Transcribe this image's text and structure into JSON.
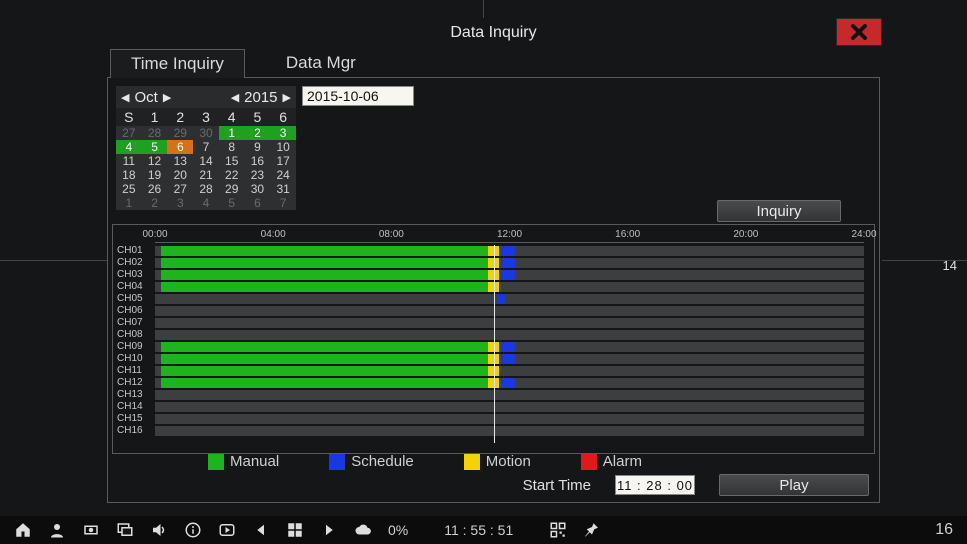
{
  "window": {
    "title": "Data  Inquiry",
    "tabs": [
      {
        "label": "Time  Inquiry",
        "active": true
      },
      {
        "label": "Data  Mgr",
        "active": false
      }
    ]
  },
  "calendar": {
    "month_label": "Oct",
    "year_label": "2015",
    "dow": [
      "S",
      "1",
      "2",
      "3",
      "4",
      "5",
      "6"
    ],
    "cells": [
      {
        "n": "27",
        "cls": "other"
      },
      {
        "n": "28",
        "cls": "other"
      },
      {
        "n": "29",
        "cls": "other"
      },
      {
        "n": "30",
        "cls": "other"
      },
      {
        "n": "1",
        "cls": "rec"
      },
      {
        "n": "2",
        "cls": "rec"
      },
      {
        "n": "3",
        "cls": "rec"
      },
      {
        "n": "4",
        "cls": "rec"
      },
      {
        "n": "5",
        "cls": "rec"
      },
      {
        "n": "6",
        "cls": "sel"
      },
      {
        "n": "7",
        "cls": ""
      },
      {
        "n": "8",
        "cls": ""
      },
      {
        "n": "9",
        "cls": ""
      },
      {
        "n": "10",
        "cls": ""
      },
      {
        "n": "11",
        "cls": ""
      },
      {
        "n": "12",
        "cls": ""
      },
      {
        "n": "13",
        "cls": ""
      },
      {
        "n": "14",
        "cls": ""
      },
      {
        "n": "15",
        "cls": ""
      },
      {
        "n": "16",
        "cls": ""
      },
      {
        "n": "17",
        "cls": ""
      },
      {
        "n": "18",
        "cls": ""
      },
      {
        "n": "19",
        "cls": ""
      },
      {
        "n": "20",
        "cls": ""
      },
      {
        "n": "21",
        "cls": ""
      },
      {
        "n": "22",
        "cls": ""
      },
      {
        "n": "23",
        "cls": ""
      },
      {
        "n": "24",
        "cls": ""
      },
      {
        "n": "25",
        "cls": ""
      },
      {
        "n": "26",
        "cls": ""
      },
      {
        "n": "27",
        "cls": ""
      },
      {
        "n": "28",
        "cls": ""
      },
      {
        "n": "29",
        "cls": ""
      },
      {
        "n": "30",
        "cls": ""
      },
      {
        "n": "31",
        "cls": ""
      },
      {
        "n": "1",
        "cls": "other"
      },
      {
        "n": "2",
        "cls": "other"
      },
      {
        "n": "3",
        "cls": "other"
      },
      {
        "n": "4",
        "cls": "other"
      },
      {
        "n": "5",
        "cls": "other"
      },
      {
        "n": "6",
        "cls": "other"
      },
      {
        "n": "7",
        "cls": "other"
      }
    ]
  },
  "date_field": "2015-10-06",
  "buttons": {
    "inquiry": "Inquiry",
    "play": "Play"
  },
  "timeline": {
    "ticks": [
      "00:00",
      "04:00",
      "08:00",
      "12:00",
      "16:00",
      "20:00",
      "24:00"
    ],
    "playhead_pct": 47.8,
    "channels": [
      {
        "label": "CH01",
        "segs": [
          {
            "t": "manual",
            "s": 0.8,
            "e": 47.0
          },
          {
            "t": "motion",
            "s": 47.0,
            "e": 48.5
          },
          {
            "t": "schedule",
            "s": 49.0,
            "e": 50.8
          }
        ]
      },
      {
        "label": "CH02",
        "segs": [
          {
            "t": "manual",
            "s": 0.8,
            "e": 47.0
          },
          {
            "t": "motion",
            "s": 47.0,
            "e": 48.5
          },
          {
            "t": "schedule",
            "s": 49.0,
            "e": 50.8
          }
        ]
      },
      {
        "label": "CH03",
        "segs": [
          {
            "t": "manual",
            "s": 0.8,
            "e": 47.0
          },
          {
            "t": "motion",
            "s": 47.0,
            "e": 48.5
          },
          {
            "t": "schedule",
            "s": 49.0,
            "e": 50.8
          }
        ]
      },
      {
        "label": "CH04",
        "segs": [
          {
            "t": "manual",
            "s": 0.8,
            "e": 47.0
          },
          {
            "t": "motion",
            "s": 47.0,
            "e": 48.5
          }
        ]
      },
      {
        "label": "CH05",
        "segs": [
          {
            "t": "schedule",
            "s": 48.3,
            "e": 49.3
          }
        ]
      },
      {
        "label": "CH06",
        "segs": []
      },
      {
        "label": "CH07",
        "segs": []
      },
      {
        "label": "CH08",
        "segs": []
      },
      {
        "label": "CH09",
        "segs": [
          {
            "t": "manual",
            "s": 0.8,
            "e": 47.0
          },
          {
            "t": "motion",
            "s": 47.0,
            "e": 48.5
          },
          {
            "t": "schedule",
            "s": 49.0,
            "e": 50.8
          }
        ]
      },
      {
        "label": "CH10",
        "segs": [
          {
            "t": "manual",
            "s": 0.8,
            "e": 47.0
          },
          {
            "t": "motion",
            "s": 47.0,
            "e": 48.5
          },
          {
            "t": "schedule",
            "s": 49.0,
            "e": 50.8
          }
        ]
      },
      {
        "label": "CH11",
        "segs": [
          {
            "t": "manual",
            "s": 0.8,
            "e": 47.0
          },
          {
            "t": "motion",
            "s": 47.0,
            "e": 48.5
          }
        ]
      },
      {
        "label": "CH12",
        "segs": [
          {
            "t": "manual",
            "s": 0.8,
            "e": 47.0
          },
          {
            "t": "motion",
            "s": 47.0,
            "e": 48.5
          },
          {
            "t": "schedule",
            "s": 49.0,
            "e": 50.8
          }
        ]
      },
      {
        "label": "CH13",
        "segs": []
      },
      {
        "label": "CH14",
        "segs": []
      },
      {
        "label": "CH15",
        "segs": []
      },
      {
        "label": "CH16",
        "segs": []
      }
    ]
  },
  "legend": {
    "manual": {
      "label": "Manual",
      "color": "#1eb41e"
    },
    "schedule": {
      "label": "Schedule",
      "color": "#1838e0"
    },
    "motion": {
      "label": "Motion",
      "color": "#f2d20a"
    },
    "alarm": {
      "label": "Alarm",
      "color": "#e01a1a"
    }
  },
  "start_time": {
    "label": "Start  Time",
    "value": "11 : 28 : 00"
  },
  "taskbar": {
    "percent": "0%",
    "clock": "11 : 55 : 51",
    "right_num": "16"
  },
  "corner_num": "14"
}
